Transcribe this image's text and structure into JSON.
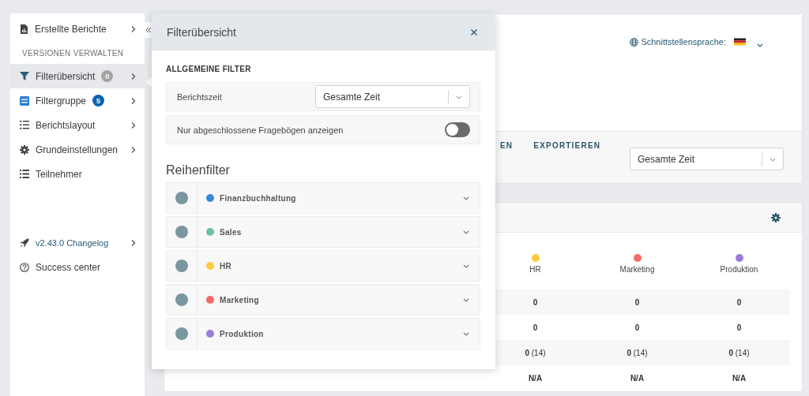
{
  "sidebar": {
    "items": [
      {
        "kind": "item",
        "label": "Erstellte Berichte",
        "chevron": true,
        "selected": false
      },
      {
        "kind": "section",
        "label": "VERSIONEN VERWALTEN"
      },
      {
        "kind": "item",
        "label": "Filterübersicht",
        "badge": {
          "text": "0",
          "color": "#a3a3a3"
        },
        "chevron": true,
        "selected": true
      },
      {
        "kind": "item",
        "label": "Filtergruppe",
        "badge": {
          "text": "5",
          "color": "#0b63b0"
        },
        "chevron": true,
        "selected": false
      },
      {
        "kind": "item",
        "label": "Berichtslayout",
        "chevron": true,
        "selected": false
      },
      {
        "kind": "item",
        "label": "Grundeinstellungen",
        "chevron": true,
        "selected": false
      },
      {
        "kind": "item",
        "label": "Teilnehmer",
        "chevron": false,
        "selected": false
      }
    ],
    "footer_items": [
      {
        "kind": "link",
        "label": "v2.43.0 Changelog",
        "chevron": true,
        "selected": false
      },
      {
        "kind": "item",
        "label": "Success center",
        "chevron": false,
        "selected": false
      }
    ]
  },
  "header": {
    "language_label": "Schnittstellensprache:"
  },
  "tabs": [
    {
      "label": "EN",
      "selected": false
    },
    {
      "label": "EXPORTIEREN",
      "selected": false
    }
  ],
  "period_select": {
    "value": "Gesamte Zeit"
  },
  "results": {
    "columns": [
      {
        "name": "HR",
        "color": "#fdcb3c"
      },
      {
        "name": "Marketing",
        "color": "#f86868"
      },
      {
        "name": "Produktion",
        "color": "#9b7bd9"
      }
    ],
    "rows": [
      {
        "bold": true,
        "cells": [
          "0",
          "0",
          "0"
        ]
      },
      {
        "bold": true,
        "cells": [
          "0",
          "0",
          "0"
        ]
      },
      {
        "bold": false,
        "cells": [
          "**0** (14)",
          "**0** (14)",
          "**0** (14)"
        ]
      },
      {
        "bold": true,
        "cells": [
          "N/A",
          "N/A",
          "N/A"
        ]
      }
    ]
  },
  "popover": {
    "title": "Filterübersicht",
    "general": {
      "heading": "ALLGEMEINE FILTER",
      "period_label": "Berichtszeit",
      "period_value": "Gesamte Zeit",
      "completed_label": "Nur abgeschlossene Fragebögen anzeigen",
      "completed_on": false
    },
    "row_filters": {
      "heading": "Reihenfilter",
      "items": [
        {
          "name": "Finanzbuchhaltung",
          "color": "#3a87d8",
          "expanded": false
        },
        {
          "name": "Sales",
          "color": "#6cbfad",
          "expanded": false
        },
        {
          "name": "HR",
          "color": "#fdcb3c",
          "expanded": false
        },
        {
          "name": "Marketing",
          "color": "#f86868",
          "expanded": false
        },
        {
          "name": "Produktion",
          "color": "#9b7bd9",
          "expanded": false
        }
      ]
    }
  }
}
